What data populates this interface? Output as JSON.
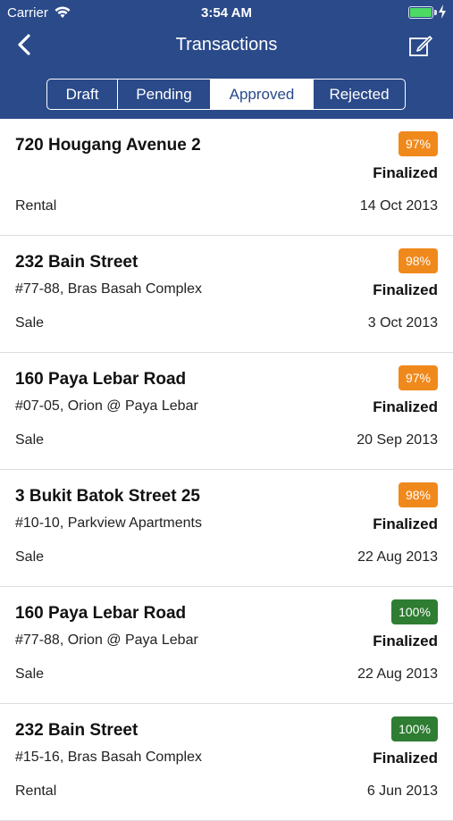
{
  "status_bar": {
    "carrier": "Carrier",
    "time": "3:54 AM"
  },
  "navbar": {
    "title": "Transactions",
    "back_icon": "chevron-left-icon",
    "compose_icon": "compose-icon"
  },
  "segments": [
    {
      "label": "Draft",
      "active": false
    },
    {
      "label": "Pending",
      "active": false
    },
    {
      "label": "Approved",
      "active": true
    },
    {
      "label": "Rejected",
      "active": false
    }
  ],
  "colors": {
    "header_bg": "#2a4a8a",
    "badge_orange": "#f0891c",
    "badge_green": "#2e7d32",
    "battery": "#4cd964"
  },
  "transactions": [
    {
      "address": "720 Hougang Avenue 2",
      "unit": "",
      "type": "Rental",
      "percent": "97%",
      "percent_color": "orange",
      "status": "Finalized",
      "date": "14 Oct 2013"
    },
    {
      "address": "232 Bain Street",
      "unit": "#77-88, Bras Basah Complex",
      "type": "Sale",
      "percent": "98%",
      "percent_color": "orange",
      "status": "Finalized",
      "date": "3 Oct 2013"
    },
    {
      "address": "160 Paya Lebar Road",
      "unit": "#07-05, Orion @ Paya Lebar",
      "type": "Sale",
      "percent": "97%",
      "percent_color": "orange",
      "status": "Finalized",
      "date": "20 Sep 2013"
    },
    {
      "address": "3 Bukit Batok Street 25",
      "unit": "#10-10, Parkview Apartments",
      "type": "Sale",
      "percent": "98%",
      "percent_color": "orange",
      "status": "Finalized",
      "date": "22 Aug 2013"
    },
    {
      "address": "160 Paya Lebar Road",
      "unit": "#77-88, Orion @ Paya Lebar",
      "type": "Sale",
      "percent": "100%",
      "percent_color": "green",
      "status": "Finalized",
      "date": "22 Aug 2013"
    },
    {
      "address": "232 Bain Street",
      "unit": "#15-16, Bras Basah Complex",
      "type": "Rental",
      "percent": "100%",
      "percent_color": "green",
      "status": "Finalized",
      "date": "6 Jun 2013"
    }
  ]
}
